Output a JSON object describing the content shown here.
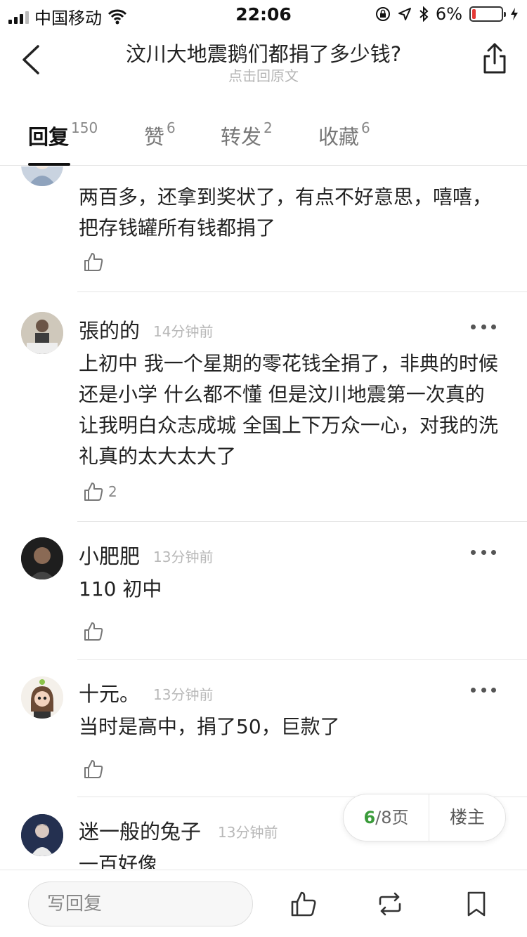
{
  "status_bar": {
    "carrier": "中国移动",
    "time": "22:06",
    "battery": "6%",
    "battery_level": 0.06,
    "battery_color": "#e53935"
  },
  "nav": {
    "title": "汶川大地震鹅们都捐了多少钱?",
    "subtitle": "点击回原文",
    "back_icon": "chevron-left-icon",
    "share_icon": "share-icon"
  },
  "tabs": [
    {
      "label": "回复",
      "count": "150",
      "active": true
    },
    {
      "label": "赞",
      "count": "6",
      "active": false
    },
    {
      "label": "转发",
      "count": "2",
      "active": false
    },
    {
      "label": "收藏",
      "count": "6",
      "active": false
    }
  ],
  "comments": [
    {
      "username": "",
      "time": "",
      "text": "两百多，还拿到奖状了，有点不好意思，嘻嘻，把存钱罐所有钱都捐了",
      "likes": ""
    },
    {
      "username": "張的的",
      "time": "14分钟前",
      "text": "上初中 我一个星期的零花钱全捐了，非典的时候还是小学 什么都不懂 但是汶川地震第一次真的让我明白众志成城 全国上下万众一心，对我的洗礼真的太大太大了",
      "likes": "2"
    },
    {
      "username": "小肥肥",
      "time": "13分钟前",
      "text": "110 初中",
      "likes": ""
    },
    {
      "username": "十元。",
      "time": "13分钟前",
      "text": "当时是高中，捐了50，巨款了",
      "likes": ""
    },
    {
      "username": "迷一般的兔子",
      "time": "13分钟前",
      "text": "一百好像",
      "likes": ""
    }
  ],
  "pager": {
    "current": "6",
    "total": "/8页",
    "owner_label": "楼主"
  },
  "bottom_bar": {
    "reply_placeholder": "写回复",
    "like_icon": "thumbs-up-icon",
    "repost_icon": "repost-icon",
    "bookmark_icon": "bookmark-icon"
  },
  "colors": {
    "accent_green": "#3a9b3a",
    "text_primary": "#222222",
    "text_muted": "#b8b8b8"
  }
}
